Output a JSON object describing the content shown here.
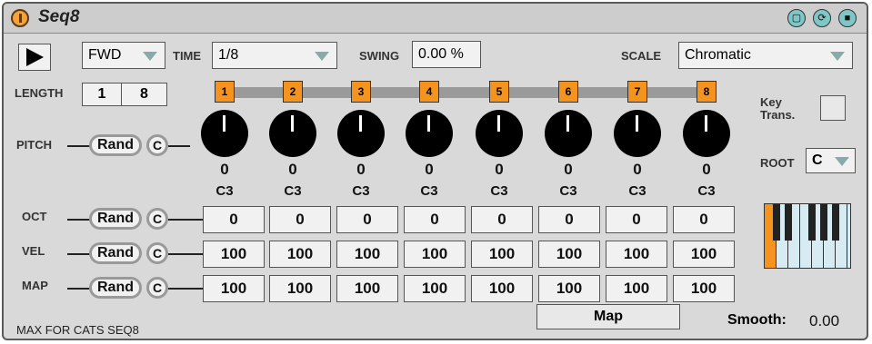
{
  "device": {
    "title": "Seq8",
    "footer": "MAX FOR CATS SEQ8"
  },
  "header_buttons": [
    "chip-icon",
    "refresh-icon",
    "save-icon"
  ],
  "transport": {
    "direction": "FWD",
    "time_label": "TIME",
    "time": "1/8",
    "swing_label": "SWING",
    "swing": "0.00 %",
    "scale_label": "SCALE",
    "scale": "Chromatic"
  },
  "length": {
    "label": "LENGTH",
    "start": "1",
    "end": "8"
  },
  "steps": [
    "1",
    "2",
    "3",
    "4",
    "5",
    "6",
    "7",
    "8"
  ],
  "pitch": {
    "label": "PITCH",
    "values": [
      "0",
      "0",
      "0",
      "0",
      "0",
      "0",
      "0",
      "0"
    ],
    "notes": [
      "C3",
      "C3",
      "C3",
      "C3",
      "C3",
      "C3",
      "C3",
      "C3"
    ]
  },
  "oct": {
    "label": "OCT",
    "values": [
      "0",
      "0",
      "0",
      "0",
      "0",
      "0",
      "0",
      "0"
    ]
  },
  "vel": {
    "label": "VEL",
    "values": [
      "100",
      "100",
      "100",
      "100",
      "100",
      "100",
      "100",
      "100"
    ]
  },
  "map": {
    "label": "MAP",
    "values": [
      "100",
      "100",
      "100",
      "100",
      "100",
      "100",
      "100",
      "100"
    ]
  },
  "controls": {
    "rand": "Rand",
    "clear": "C",
    "map_button": "Map",
    "smooth_label": "Smooth:",
    "smooth_value": "0.00"
  },
  "key": {
    "trans_label": "Key\nTrans.",
    "root_label": "ROOT",
    "root": "C"
  },
  "colors": {
    "accent": "#f4931e",
    "panel": "#d9d9d9",
    "header_btn": "#7fc7c7"
  }
}
